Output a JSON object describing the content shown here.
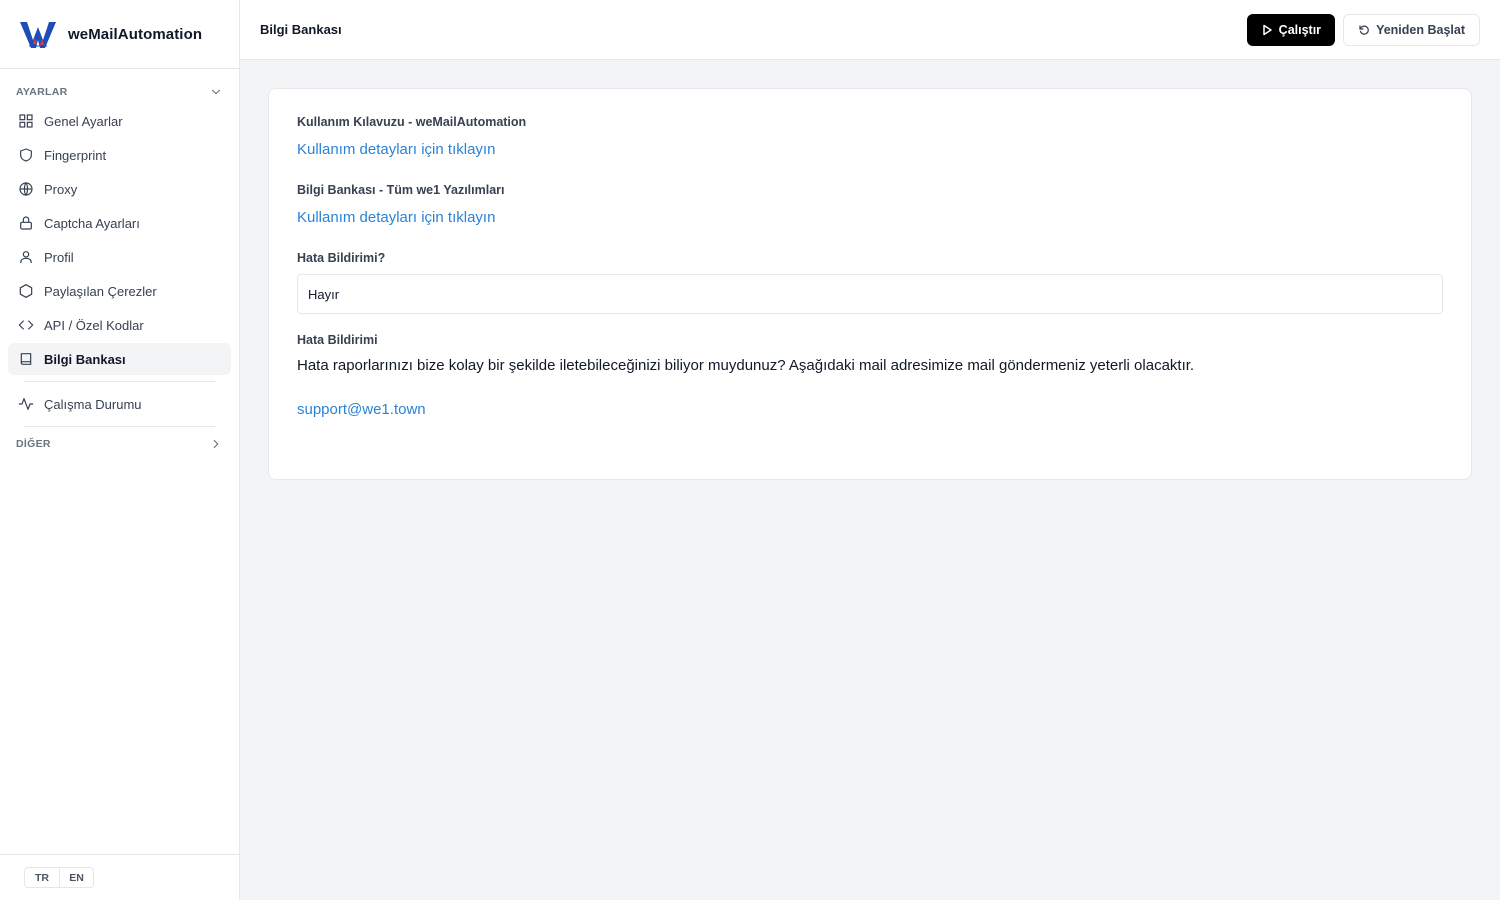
{
  "brand": {
    "name": "weMailAutomation"
  },
  "sidebar": {
    "section_settings": "AYARLAR",
    "items": [
      {
        "label": "Genel Ayarlar",
        "icon": "grid-icon"
      },
      {
        "label": "Fingerprint",
        "icon": "shield-icon"
      },
      {
        "label": "Proxy",
        "icon": "globe-icon"
      },
      {
        "label": "Captcha Ayarları",
        "icon": "lock-icon"
      },
      {
        "label": "Profil",
        "icon": "user-icon"
      },
      {
        "label": "Paylaşılan Çerezler",
        "icon": "hexagon-icon"
      },
      {
        "label": "API / Özel Kodlar",
        "icon": "code-icon"
      },
      {
        "label": "Bilgi Bankası",
        "icon": "book-icon",
        "active": true
      }
    ],
    "status_item": {
      "label": "Çalışma Durumu",
      "icon": "activity-icon"
    },
    "section_other": "DİĞER"
  },
  "language": {
    "tr": "TR",
    "en": "EN"
  },
  "header": {
    "title": "Bilgi Bankası",
    "run_label": "Çalıştır",
    "restart_label": "Yeniden Başlat"
  },
  "content": {
    "guide_label": "Kullanım Kılavuzu - weMailAutomation",
    "guide_link": "Kullanım detayları için tıklayın",
    "kb_label": "Bilgi Bankası - Tüm we1 Yazılımları",
    "kb_link": "Kullanım detayları için tıklayın",
    "error_question_label": "Hata Bildirimi?",
    "error_question_value": "Hayır",
    "error_label": "Hata Bildirimi",
    "error_text": "Hata raporlarınızı bize kolay bir şekilde iletebileceğinizi biliyor muydunuz? Aşağıdaki mail adresimize mail göndermeniz yeterli olacaktır.",
    "support_email": "support@we1.town"
  },
  "colors": {
    "accent_link": "#2b83d6",
    "primary_button": "#000000",
    "logo_blue": "#1e4db7",
    "logo_red": "#e53935"
  }
}
